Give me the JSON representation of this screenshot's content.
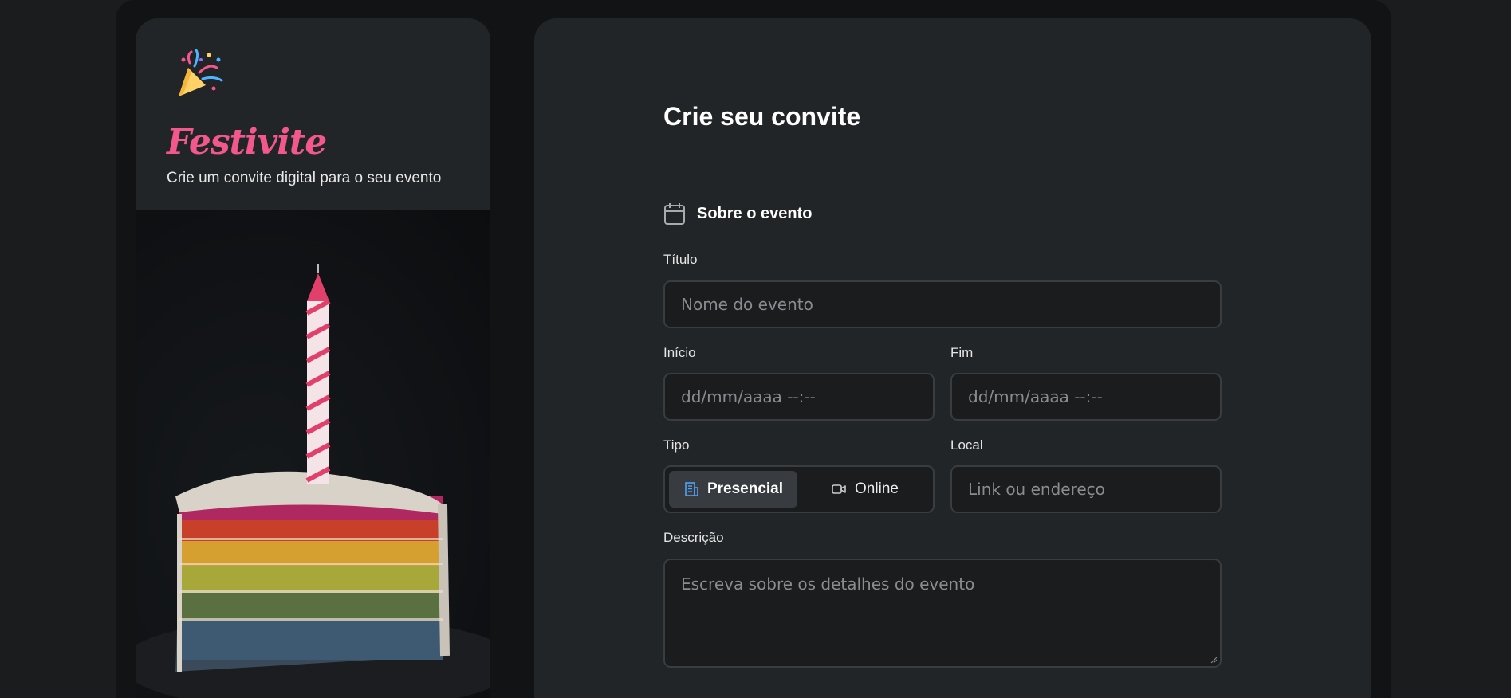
{
  "brand": {
    "name": "Festivite",
    "tagline": "Crie um convite digital para o seu evento",
    "logo_icon": "party-popper-icon",
    "brand_color": "#f2588b"
  },
  "form": {
    "title": "Crie seu convite",
    "section": {
      "icon": "calendar-icon",
      "label": "Sobre o evento"
    },
    "fields": {
      "titulo": {
        "label": "Título",
        "placeholder": "Nome do evento"
      },
      "inicio": {
        "label": "Início",
        "placeholder": "dd/mm/aaaa --:--"
      },
      "fim": {
        "label": "Fim",
        "placeholder": "dd/mm/aaaa --:--"
      },
      "tipo": {
        "label": "Tipo",
        "options": [
          {
            "label": "Presencial",
            "icon": "building-icon",
            "selected": true
          },
          {
            "label": "Online",
            "icon": "video-camera-icon",
            "selected": false
          }
        ]
      },
      "local": {
        "label": "Local",
        "placeholder": "Link ou endereço"
      },
      "descricao": {
        "label": "Descrição",
        "placeholder": "Escreva sobre os detalhes do evento"
      }
    }
  }
}
